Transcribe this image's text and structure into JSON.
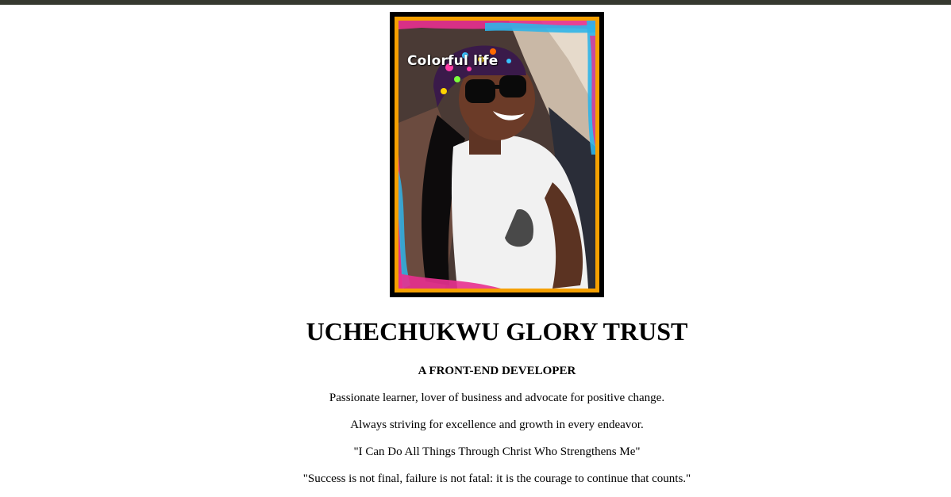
{
  "profile": {
    "photo_caption": "Colorful life",
    "name": "UCHECHUKWU GLORY TRUST",
    "role": "A FRONT-END DEVELOPER",
    "bio_lines": [
      "Passionate learner, lover of business and advocate for positive change.",
      "Always striving for excellence and growth in every endeavor.",
      "\"I Can Do All Things Through Christ Who Strengthens Me\"",
      "\"Success is not final, failure is not fatal: it is the courage to continue that counts.\""
    ]
  },
  "colors": {
    "top_bar": "#36392f",
    "frame_border": "#f5a000",
    "background": "#ffffff",
    "text": "#000000"
  }
}
